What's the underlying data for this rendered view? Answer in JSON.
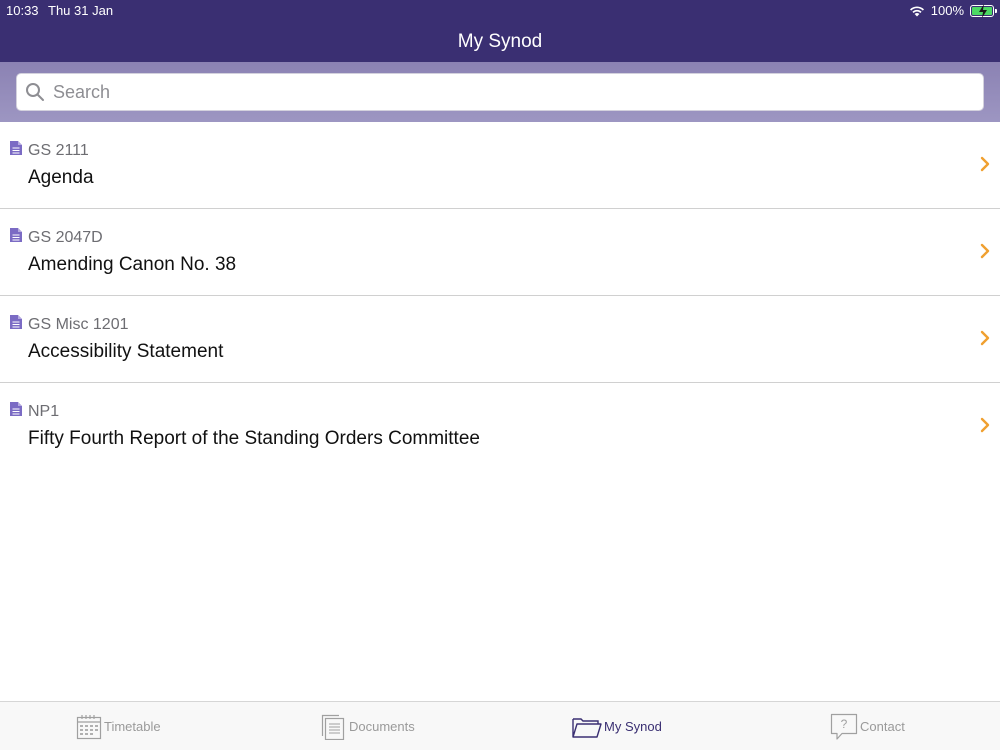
{
  "status_bar": {
    "time": "10:33",
    "date": "Thu 31 Jan",
    "battery": "100%",
    "wifi_icon": "wifi-icon",
    "battery_icon": "battery-charging-icon"
  },
  "nav": {
    "title": "My Synod"
  },
  "search": {
    "placeholder": "Search",
    "value": ""
  },
  "items": [
    {
      "code": "GS 2111",
      "title": "Agenda"
    },
    {
      "code": "GS 2047D",
      "title": "Amending Canon No. 38"
    },
    {
      "code": "GS Misc 1201",
      "title": "Accessibility Statement"
    },
    {
      "code": "NP1",
      "title": "Fifty Fourth Report of the Standing Orders Committee"
    }
  ],
  "tabs": [
    {
      "label": "Timetable",
      "icon": "calendar-icon",
      "active": false
    },
    {
      "label": "Documents",
      "icon": "document-icon",
      "active": false
    },
    {
      "label": "My Synod",
      "icon": "folder-icon",
      "active": true
    },
    {
      "label": "Contact",
      "icon": "question-bubble-icon",
      "active": false
    }
  ],
  "colors": {
    "nav_background": "#3a2f72",
    "search_band": "#9d96c2",
    "chevron": "#f0a030",
    "doc_icon": "#7b6bc4",
    "battery_fill": "#4cd964"
  }
}
